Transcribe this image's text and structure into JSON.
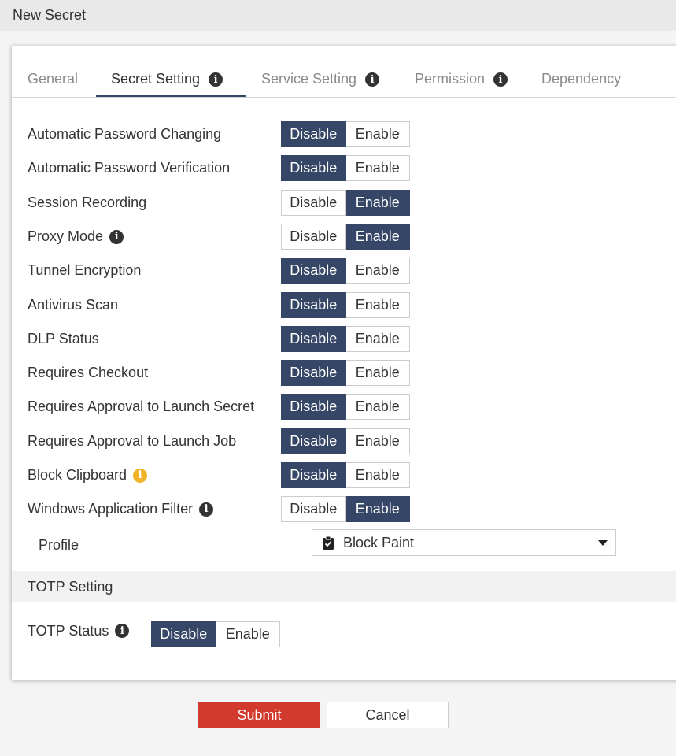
{
  "window": {
    "title": "New Secret"
  },
  "tabs": [
    {
      "label": "General",
      "active": false,
      "info": false
    },
    {
      "label": "Secret Setting",
      "active": true,
      "info": true
    },
    {
      "label": "Service Setting",
      "active": false,
      "info": true
    },
    {
      "label": "Permission",
      "active": false,
      "info": true
    },
    {
      "label": "Dependency",
      "active": false,
      "info": false
    }
  ],
  "toggle_labels": {
    "off": "Disable",
    "on": "Enable"
  },
  "settings": [
    {
      "label": "Automatic Password Changing",
      "value": "Disable",
      "info": "none"
    },
    {
      "label": "Automatic Password Verification",
      "value": "Disable",
      "info": "none"
    },
    {
      "label": "Session Recording",
      "value": "Enable",
      "info": "none"
    },
    {
      "label": "Proxy Mode",
      "value": "Enable",
      "info": "dark"
    },
    {
      "label": "Tunnel Encryption",
      "value": "Disable",
      "info": "none"
    },
    {
      "label": "Antivirus Scan",
      "value": "Disable",
      "info": "none"
    },
    {
      "label": "DLP Status",
      "value": "Disable",
      "info": "none"
    },
    {
      "label": "Requires Checkout",
      "value": "Disable",
      "info": "none"
    },
    {
      "label": "Requires Approval to Launch Secret",
      "value": "Disable",
      "info": "none"
    },
    {
      "label": "Requires Approval to Launch Job",
      "value": "Disable",
      "info": "none"
    },
    {
      "label": "Block Clipboard",
      "value": "Disable",
      "info": "yellow"
    },
    {
      "label": "Windows Application Filter",
      "value": "Enable",
      "info": "dark"
    }
  ],
  "profile": {
    "label": "Profile",
    "value": "Block Paint",
    "icon": "clipboard-check-icon"
  },
  "totp": {
    "section_title": "TOTP Setting",
    "status_label": "TOTP Status",
    "value": "Disable"
  },
  "actions": {
    "submit": "Submit",
    "cancel": "Cancel"
  },
  "colors": {
    "accent": "#364666",
    "submit": "#d13a2c",
    "warning_info": "#f0b429"
  }
}
